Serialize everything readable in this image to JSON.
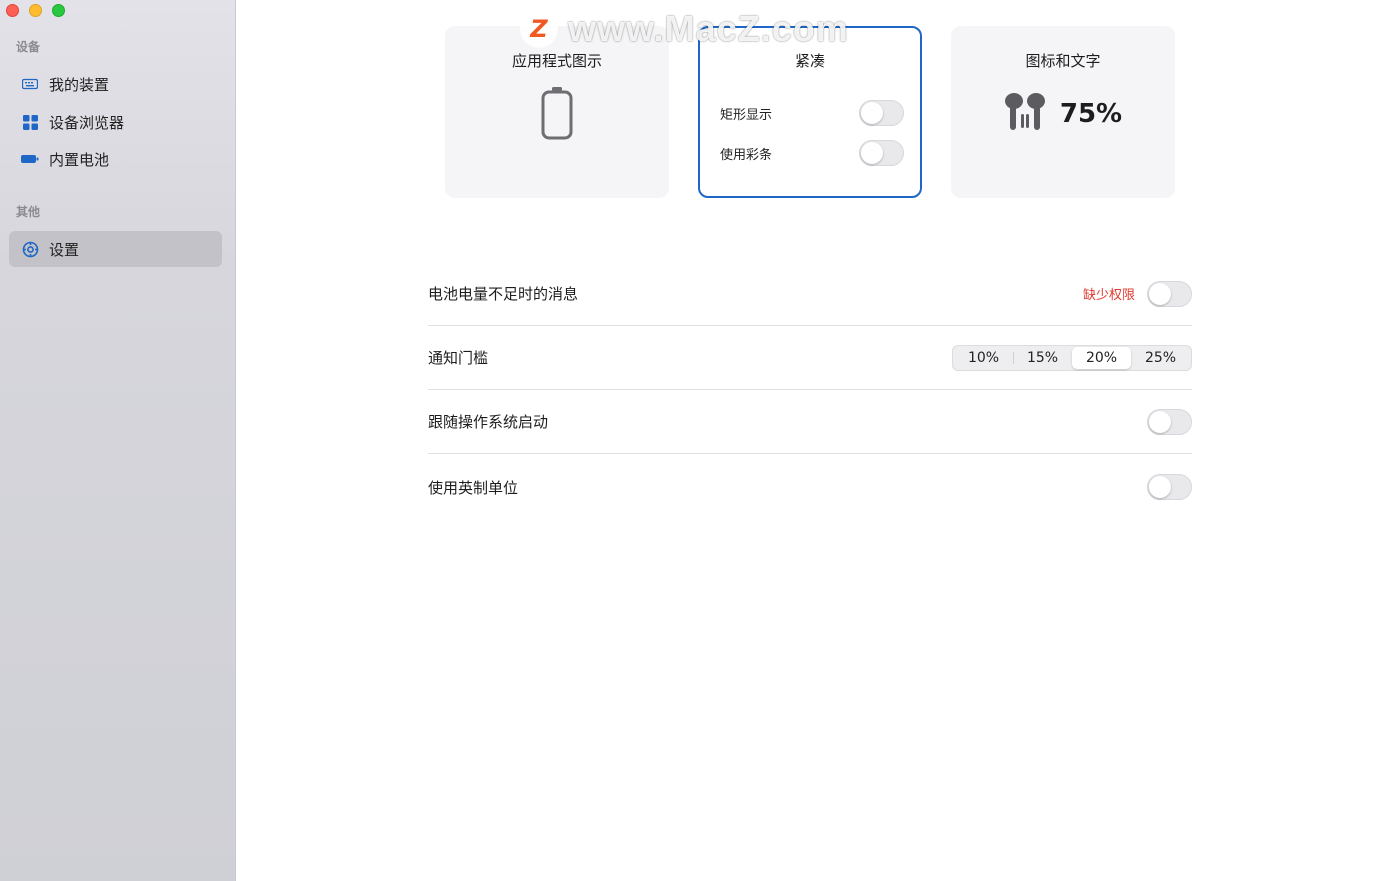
{
  "sidebar": {
    "section_devices": "设备",
    "section_other": "其他",
    "items": [
      {
        "label": "我的装置",
        "icon": "keyboard-icon"
      },
      {
        "label": "设备浏览器",
        "icon": "grid-icon"
      },
      {
        "label": "内置电池",
        "icon": "battery-icon"
      },
      {
        "label": "设置",
        "icon": "gear-icon",
        "active": true
      }
    ]
  },
  "cards": {
    "app_icon": {
      "title": "应用程式图示"
    },
    "compact": {
      "title": "紧凑",
      "rect_label": "矩形显示",
      "color_label": "使用彩条",
      "rect_on": false,
      "color_on": false
    },
    "icon_text": {
      "title": "图标和文字",
      "percent": "75%"
    }
  },
  "settings": {
    "low_battery": {
      "label": "电池电量不足时的消息",
      "warning": "缺少权限",
      "on": false
    },
    "threshold": {
      "label": "通知门槛",
      "options": [
        "10%",
        "15%",
        "20%",
        "25%"
      ],
      "selected": "20%"
    },
    "launch_at_login": {
      "label": "跟随操作系统启动",
      "on": false
    },
    "imperial": {
      "label": "使用英制单位",
      "on": false
    }
  },
  "watermark": {
    "logo": "Z",
    "text": "www.MacZ.com"
  },
  "colors": {
    "accent": "#1f67c6",
    "warning": "#e03a2f"
  }
}
